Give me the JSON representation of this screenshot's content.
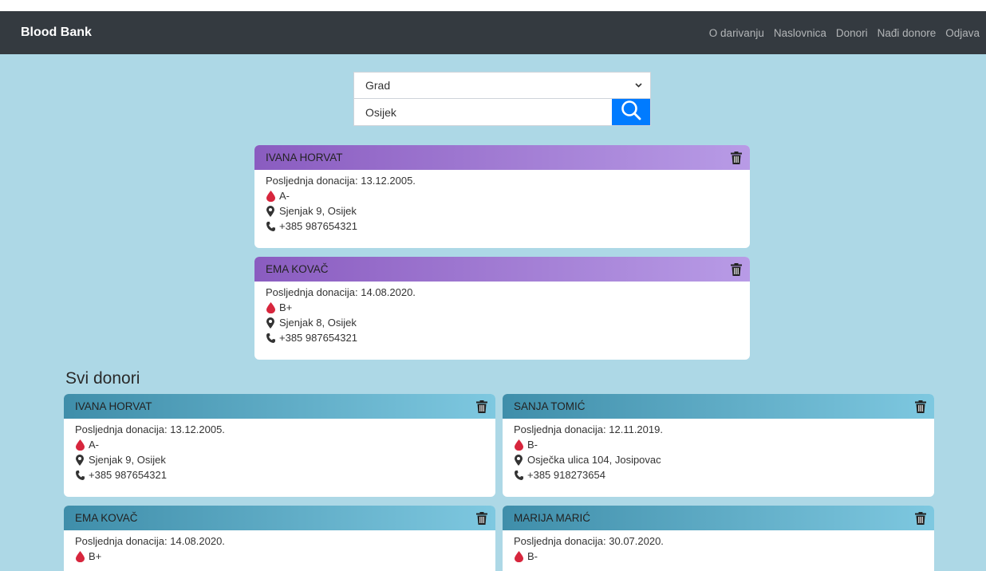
{
  "navbar": {
    "brand": "Blood Bank",
    "links": [
      "O darivanju",
      "Naslovnica",
      "Donori",
      "Nađi donore",
      "Odjava"
    ]
  },
  "search": {
    "select_value": "Grad",
    "input_value": "Osijek"
  },
  "results": [
    {
      "name": "IVANA HORVAT",
      "last_donation": "Posljednja donacija: 13.12.2005.",
      "blood": "A-",
      "address": "Sjenjak 9, Osijek",
      "phone": "+385 987654321"
    },
    {
      "name": "EMA KOVAČ",
      "last_donation": "Posljednja donacija: 14.08.2020.",
      "blood": "B+",
      "address": "Sjenjak 8, Osijek",
      "phone": "+385 987654321"
    }
  ],
  "all_donors": {
    "title": "Svi donori",
    "items": [
      {
        "name": "IVANA HORVAT",
        "last_donation": "Posljednja donacija: 13.12.2005.",
        "blood": "A-",
        "address": "Sjenjak 9, Osijek",
        "phone": "+385 987654321"
      },
      {
        "name": "SANJA TOMIĆ",
        "last_donation": "Posljednja donacija: 12.11.2019.",
        "blood": "B-",
        "address": "Osječka ulica 104, Josipovac",
        "phone": "+385 918273654"
      },
      {
        "name": "EMA KOVAČ",
        "last_donation": "Posljednja donacija: 14.08.2020.",
        "blood": "B+"
      },
      {
        "name": "MARIJA MARIĆ",
        "last_donation": "Posljednja donacija: 30.07.2020.",
        "blood": "B-"
      }
    ]
  },
  "colors": {
    "background": "#add8e6",
    "navbar": "#343a40",
    "result_header": "#8a5cc0",
    "donor_header": "#3f8eaa",
    "blood_drop": "#d7263d",
    "search_button": "#007bff"
  },
  "icons": {
    "blood": "blood-drop-icon",
    "address": "map-marker-icon",
    "phone": "phone-icon",
    "delete": "trash-icon",
    "search": "search-icon"
  }
}
